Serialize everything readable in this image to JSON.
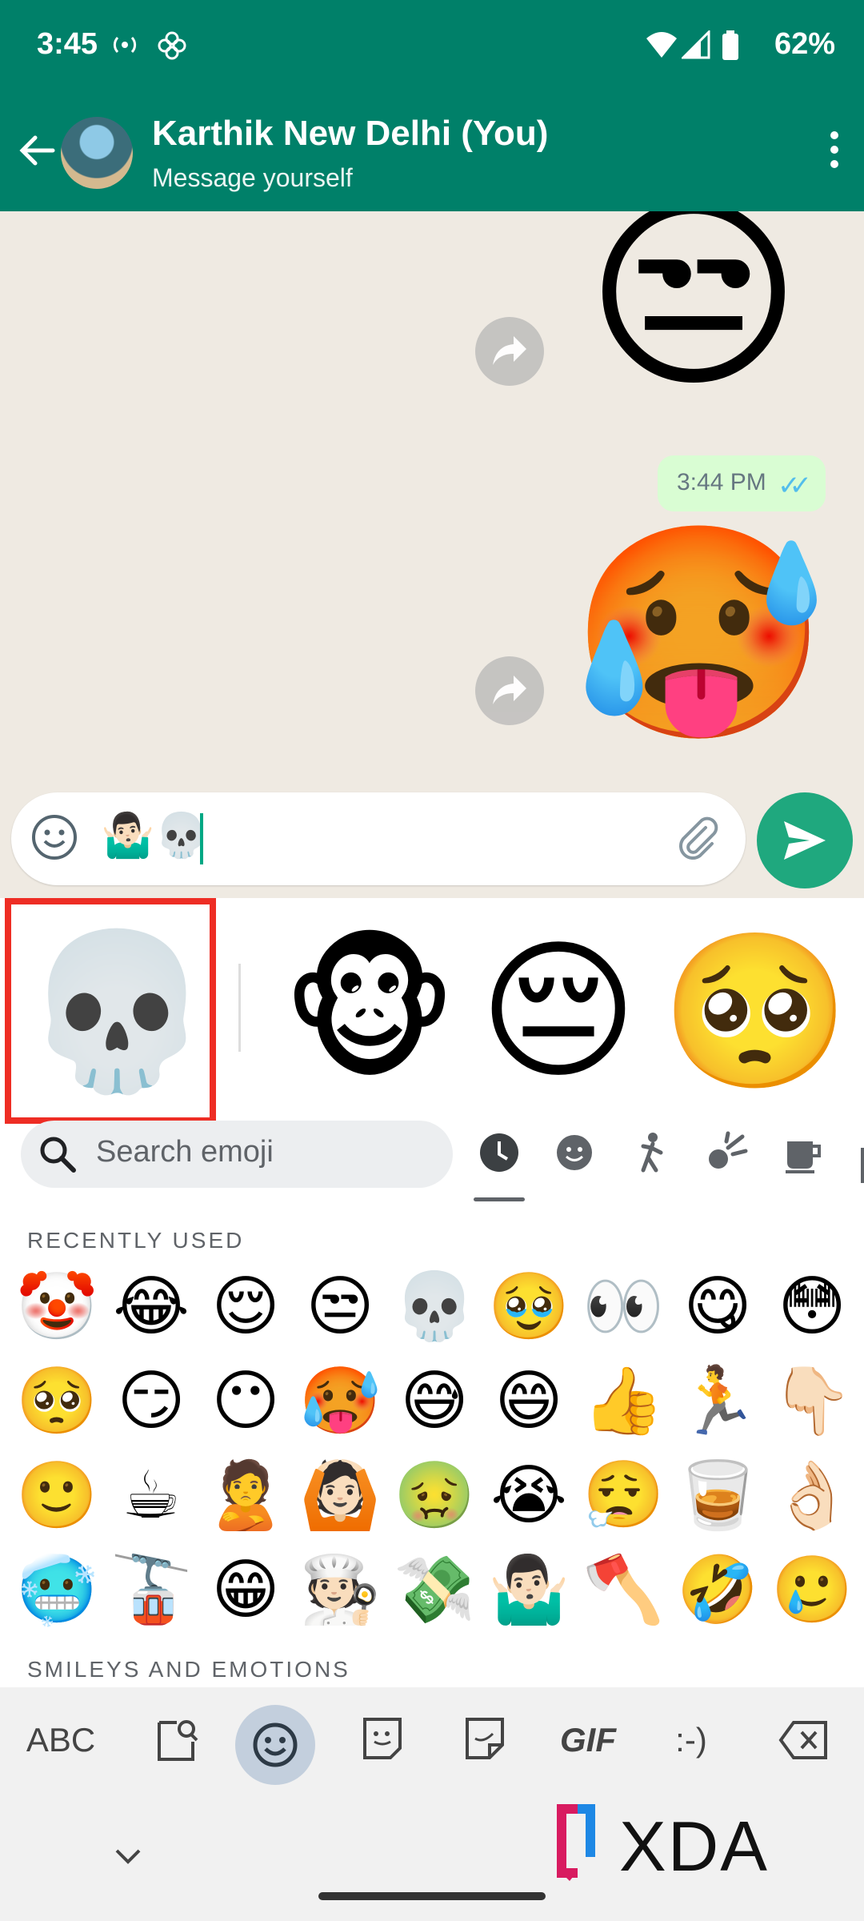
{
  "status_bar": {
    "time": "3:45",
    "battery": "62%"
  },
  "header": {
    "contact_name": "Karthik New Delhi (You)",
    "subtitle": "Message yourself"
  },
  "chat": {
    "messages": [
      {
        "type": "sticker",
        "emoji": "😒"
      },
      {
        "type": "time",
        "time": "3:44 PM",
        "ticks": "✓✓"
      },
      {
        "type": "sticker",
        "emoji": "🥵"
      }
    ]
  },
  "composer": {
    "content": "🤷🏻‍♂️💀"
  },
  "sticker_suggestions": [
    "💀",
    "🐵",
    "😔",
    "🥺"
  ],
  "search": {
    "placeholder": "Search emoji"
  },
  "sections": {
    "recent": "RECENTLY USED",
    "smileys": "SMILEYS AND EMOTIONS"
  },
  "recent_emojis": [
    "🤡",
    "😂",
    "😌",
    "😒",
    "💀",
    "🥹",
    "👀",
    "😋",
    "😳",
    "🥺",
    "😏",
    "😶",
    "🥵",
    "😅",
    "😄",
    "👍",
    "🏃",
    "👇🏻",
    "🙂",
    "☕",
    "🙎",
    "🙆🏻",
    "🤢",
    "😭",
    "😮‍💨",
    "🥃",
    "👌🏻",
    "🥶",
    "🚡",
    "😁",
    "🧑🏻‍🍳",
    "💸",
    "🤷🏻‍♂️",
    "🪓",
    "🤣",
    "🥲"
  ],
  "toolbar": {
    "abc": "ABC",
    "gif": "GIF",
    "emoticon": ":-)"
  },
  "watermark": "XDA",
  "colors": {
    "brand": "#008069",
    "send": "#1fa87e",
    "highlight": "#ee2d24",
    "bubble": "#d9fdd3"
  }
}
